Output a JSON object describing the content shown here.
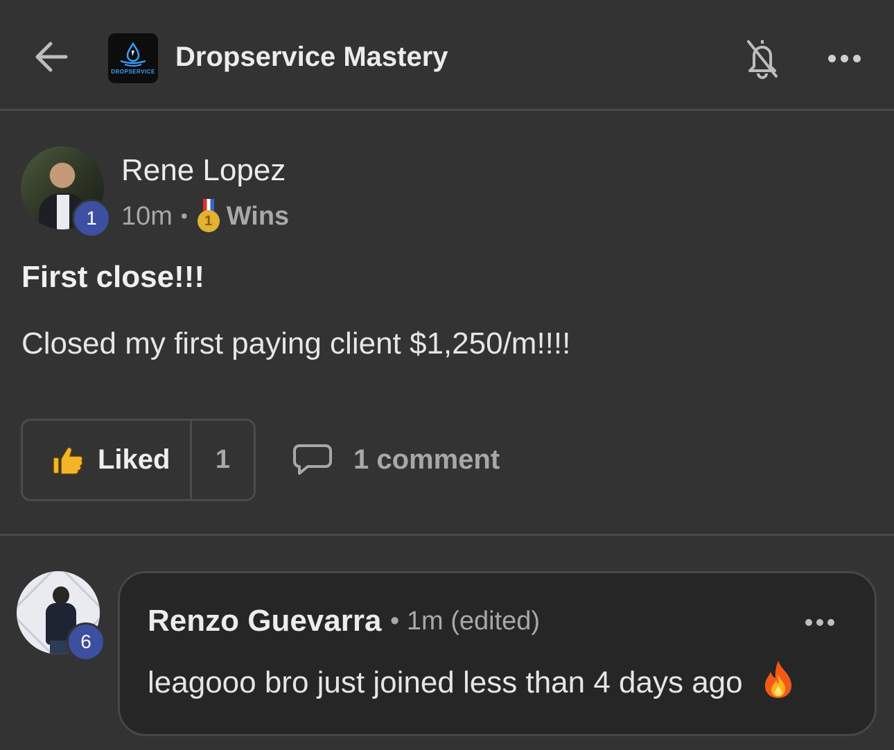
{
  "header": {
    "title": "Dropservice Mastery",
    "logo_text": "DROPSERVICE"
  },
  "post": {
    "author": "Rene Lopez",
    "level": "1",
    "time": "10m",
    "separator": "•",
    "medal_number": "1",
    "category": "Wins",
    "title": "First close!!!",
    "body": "Closed my first paying client $1,250/m!!!!",
    "like_label": "Liked",
    "like_count": "1",
    "comment_label": "1 comment"
  },
  "comment": {
    "author": "Renzo Guevarra",
    "level": "6",
    "meta": "• 1m (edited)",
    "text": "leagooo bro just joined less than 4 days ago",
    "emoji": "fire-icon"
  },
  "colors": {
    "background": "#333333",
    "level_badge": "#3c4fa0",
    "like_icon": "#f2b529",
    "fire": "#f25a1a"
  }
}
